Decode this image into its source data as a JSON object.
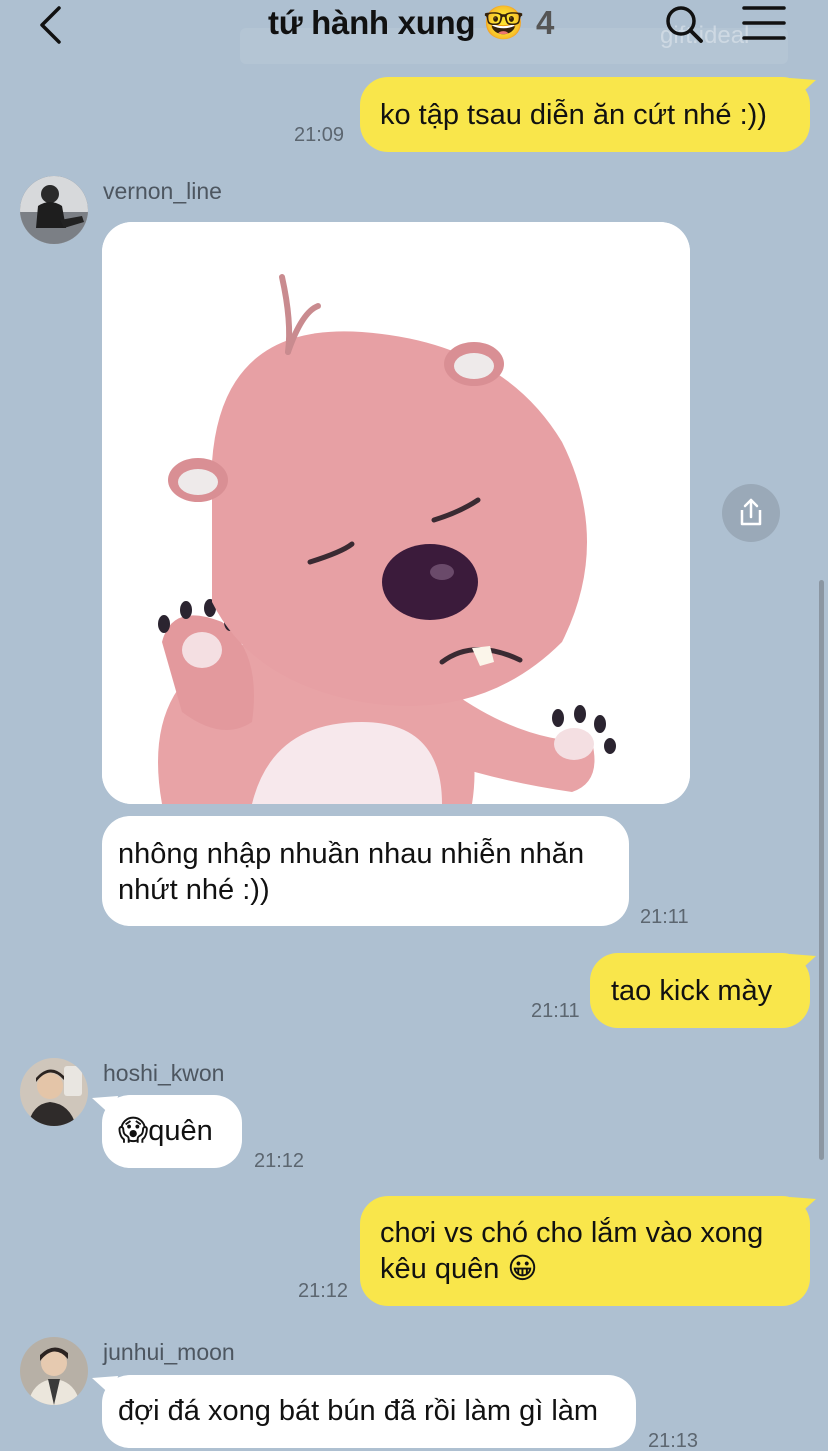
{
  "header": {
    "title": "tứ hành xung",
    "title_emoji": "🤓",
    "member_count": "4",
    "watermark": "gift.ideal"
  },
  "messages": [
    {
      "sender": "me",
      "text": "ko tập tsau diễn ăn cứt nhé :))",
      "time": "21:09"
    },
    {
      "sender": "vernon_line",
      "type": "sticker",
      "sticker_name": "loopy-pink-beaver-sticker"
    },
    {
      "sender": "vernon_line",
      "text_line1": "nhông nhập nhuần nhau nhiễn nhăn",
      "text_line2": "nhứt nhé :))",
      "time": "21:11"
    },
    {
      "sender": "me",
      "text": "tao kick mày",
      "time": "21:11"
    },
    {
      "sender": "hoshi_kwon",
      "emoji": "😱",
      "text": "quên",
      "time": "21:12"
    },
    {
      "sender": "me",
      "text_line1": "chơi vs chó cho lắm vào xong",
      "text_line2": "kêu quên",
      "emoji": "😀",
      "time": "21:12"
    },
    {
      "sender": "junhui_moon",
      "text": "đợi đá xong bát bún đã rồi làm gì làm",
      "time": "21:13"
    }
  ],
  "users": {
    "u1": "vernon_line",
    "u2": "hoshi_kwon",
    "u3": "junhui_moon"
  },
  "colors": {
    "background": "#aec0d1",
    "my_bubble": "#f9e64b",
    "their_bubble": "#ffffff"
  }
}
